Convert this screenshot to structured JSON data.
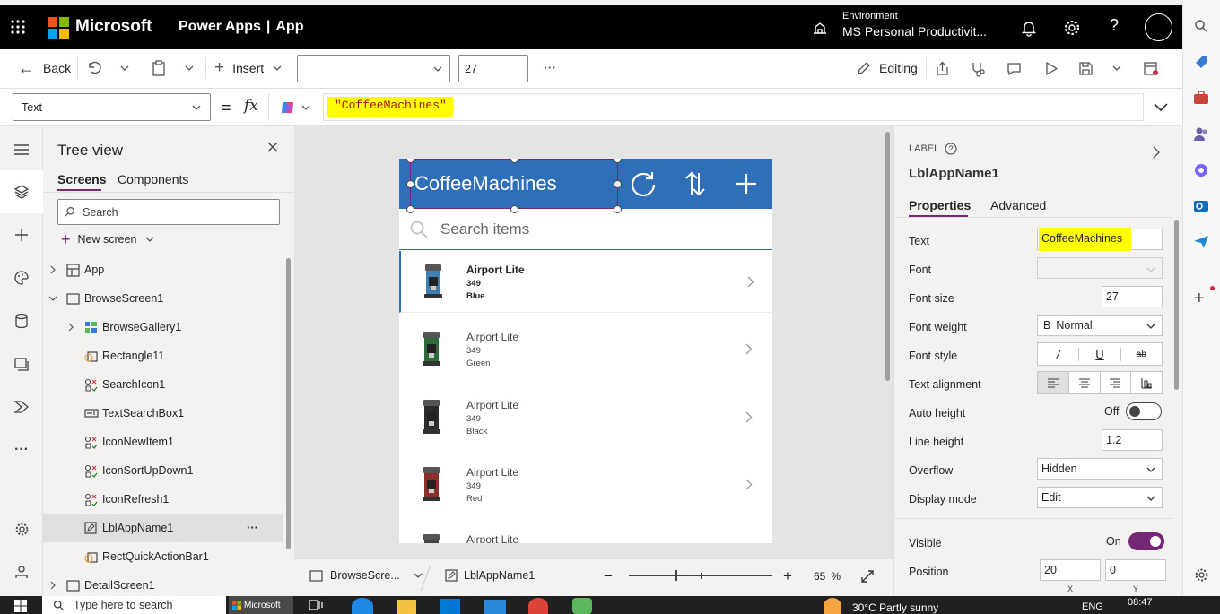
{
  "topbar": {
    "company": "Microsoft",
    "app_title": "Power Apps",
    "separator": "|",
    "page": "App",
    "env_label": "Environment",
    "env_name": "MS Personal Productivit..."
  },
  "cmdbar": {
    "back": "Back",
    "insert": "Insert",
    "font_size": "27",
    "more": "···",
    "editing": "Editing"
  },
  "formula": {
    "property": "Text",
    "equals": "=",
    "fx": "fx",
    "value": "\"CoffeeMachines\""
  },
  "tree": {
    "title": "Tree view",
    "tab_screens": "Screens",
    "tab_components": "Components",
    "search_placeholder": "Search",
    "new_screen": "New screen",
    "items": [
      {
        "label": "App"
      },
      {
        "label": "BrowseScreen1"
      },
      {
        "label": "BrowseGallery1"
      },
      {
        "label": "Rectangle11"
      },
      {
        "label": "SearchIcon1"
      },
      {
        "label": "TextSearchBox1"
      },
      {
        "label": "IconNewItem1"
      },
      {
        "label": "IconSortUpDown1"
      },
      {
        "label": "IconRefresh1"
      },
      {
        "label": "LblAppName1"
      },
      {
        "label": "RectQuickActionBar1"
      },
      {
        "label": "DetailScreen1"
      }
    ],
    "more": "···"
  },
  "app": {
    "title": "CoffeeMachines",
    "search_placeholder": "Search items",
    "items": [
      {
        "name": "Airport Lite",
        "price": "349",
        "color": "Blue",
        "machine_color": "#3e7fb4"
      },
      {
        "name": "Airport Lite",
        "price": "349",
        "color": "Green",
        "machine_color": "#2f6b3a"
      },
      {
        "name": "Airport Lite",
        "price": "349",
        "color": "Black",
        "machine_color": "#2b2b2b"
      },
      {
        "name": "Airport Lite",
        "price": "349",
        "color": "Red",
        "machine_color": "#8c2e2a"
      },
      {
        "name": "Airport Lite",
        "price": "",
        "color": "",
        "machine_color": "#444444"
      }
    ],
    "header_color": "#2f6eb8"
  },
  "statusbar": {
    "screen": "BrowseScre...",
    "control": "LblAppName1",
    "minus": "−",
    "plus": "+",
    "zoom": "65",
    "zoom_unit": "%"
  },
  "props": {
    "type": "LABEL",
    "name": "LblAppName1",
    "tab_properties": "Properties",
    "tab_advanced": "Advanced",
    "text_label": "Text",
    "text_value": "CoffeeMachines",
    "font_label": "Font",
    "font_value": "",
    "font_size_label": "Font size",
    "font_size_value": "27",
    "font_weight_label": "Font weight",
    "font_weight_icon": "B",
    "font_weight_value": "Normal",
    "font_style_label": "Font style",
    "italic": "/",
    "underline": "U",
    "strike": "ab",
    "text_alignment_label": "Text alignment",
    "auto_height_label": "Auto height",
    "auto_height_value": "Off",
    "line_height_label": "Line height",
    "line_height_value": "1.2",
    "overflow_label": "Overflow",
    "overflow_value": "Hidden",
    "display_mode_label": "Display mode",
    "display_mode_value": "Edit",
    "visible_label": "Visible",
    "visible_value": "On",
    "position_label": "Position",
    "pos_x": "20",
    "pos_y": "0",
    "x_label": "X",
    "y_label": "Y"
  },
  "taskbar": {
    "search_placeholder": "Type here to search",
    "weather": "30°C  Partly sunny",
    "lang": "ENG",
    "time": "08:47",
    "microsoft": "Microsoft"
  },
  "colors": {
    "accent": "#742774",
    "highlight": "#ffff00",
    "topbar": "#000000"
  }
}
